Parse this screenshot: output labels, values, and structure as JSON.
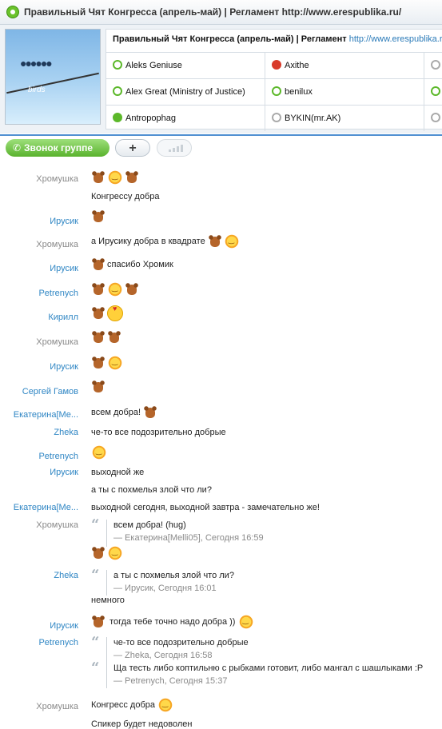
{
  "window": {
    "title": "Правильный Чят Конгресса (апрель-май) | Регламент http://www.erespublika.ru/"
  },
  "header": {
    "title": "Правильный Чят Конгресса (апрель-май) | Регламент ",
    "url": "http://www.erespublika.ru/",
    "avatar_text": "birds"
  },
  "members": [
    {
      "name": "Aleks Geniuse",
      "status": "online"
    },
    {
      "name": "Axithe",
      "status": "busy"
    },
    {
      "name": "",
      "status": "unknown"
    },
    {
      "name": "Alex Great (Ministry of Justice)",
      "status": "online"
    },
    {
      "name": "benilux",
      "status": "online"
    },
    {
      "name": "",
      "status": "online"
    },
    {
      "name": "Antropophag",
      "status": "online-check"
    },
    {
      "name": "BYKIN(mr.AK)",
      "status": "unknown"
    },
    {
      "name": "",
      "status": "unknown"
    }
  ],
  "toolbar": {
    "call_label": "Звонок группе",
    "add_label": "+"
  },
  "chat": {
    "names": {
      "n1": "Хромушка",
      "n3": "Ирусик",
      "n4": "Хромушка",
      "n5": "Ирусик",
      "n6": "Petrenych",
      "n7": "Кирилл",
      "n8": "Хромушка",
      "n9": "Ирусик",
      "n10": "Сергей Гамов",
      "n11": "Екатерина[Me...",
      "n12": "Zheka",
      "n13": "Petrenych",
      "n14": "Ирусик",
      "n16": "Екатерина[Me...",
      "n17": "Хромушка",
      "n19": "Zheka",
      "n21": "Ирусик",
      "n22": "Petrenych",
      "n23": "Хромушка"
    },
    "texts": {
      "t2": "Конгрессу добра",
      "t4": "а Ирусику добра в квадрате",
      "t5": "спасибо Хромик",
      "t11": "всем добра!",
      "t12": "че-то все подозрительно добрые",
      "t14": "выходной же",
      "t15": "а ты с похмелья злой что ли?",
      "t16": "выходной сегодня, выходной завтра - замечательно же!",
      "q17_text": "всем добра! (hug)",
      "q17_meta": "— Екатерина[Melli05], Сегодня 16:59",
      "q19_text": "а ты с похмелья злой что ли?",
      "q19_meta": "— Ирусик, Сегодня 16:01",
      "t20": "немного",
      "t21": "тогда тебе точно надо добра ))",
      "q22a_text": "че-то все подозрительно добрые",
      "q22a_meta": "— Zheka, Сегодня 16:58",
      "q22b_text": "Ща тесть либо коптильню с рыбками готовит, либо мангал с шашлыками :P",
      "q22b_meta": "— Petrenych, Сегодня 15:37",
      "t23": "Конгресс добра",
      "t24": "Спикер будет недоволен"
    }
  }
}
